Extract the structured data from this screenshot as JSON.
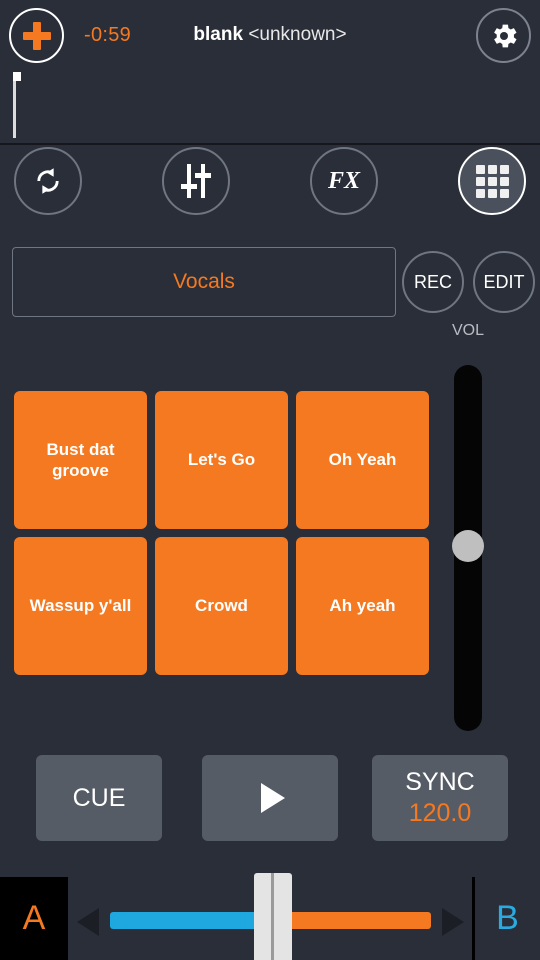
{
  "header": {
    "add_button": "+",
    "add_icon": "plus-icon",
    "time_remaining": "-0:59",
    "track_name": "blank",
    "track_artist": "<unknown>",
    "settings_icon": "gear-icon",
    "beat_icon": "beat-bars-icon"
  },
  "toolbar": {
    "buttons": [
      {
        "name": "loop",
        "icon": "loop-repeat-icon",
        "label": "",
        "active": false
      },
      {
        "name": "eq",
        "icon": "eq-sliders-icon",
        "label": "",
        "active": false
      },
      {
        "name": "fx",
        "icon": "fx-icon",
        "label": "FX",
        "active": false
      },
      {
        "name": "pads",
        "icon": "grid-icon",
        "label": "",
        "active": true
      }
    ]
  },
  "bank": {
    "selected": "Vocals",
    "rec_label": "REC",
    "edit_label": "EDIT"
  },
  "volume": {
    "label": "VOL",
    "value": 55
  },
  "pads": [
    {
      "label": "Bust dat groove"
    },
    {
      "label": "Let's Go"
    },
    {
      "label": "Oh Yeah"
    },
    {
      "label": "Wassup y'all"
    },
    {
      "label": "Crowd"
    },
    {
      "label": "Ah yeah"
    }
  ],
  "transport": {
    "cue_label": "CUE",
    "play_icon": "play-icon",
    "sync_label": "SYNC",
    "bpm": "120.0"
  },
  "crossfader": {
    "deck_a": "A",
    "deck_b": "B",
    "left_arrow": "arrow-left-icon",
    "right_arrow": "arrow-right-icon",
    "position": 50
  },
  "colors": {
    "accent_orange": "#f47920",
    "accent_blue": "#29abe2",
    "background": "#2a2e38",
    "button_gray": "#565c66"
  }
}
